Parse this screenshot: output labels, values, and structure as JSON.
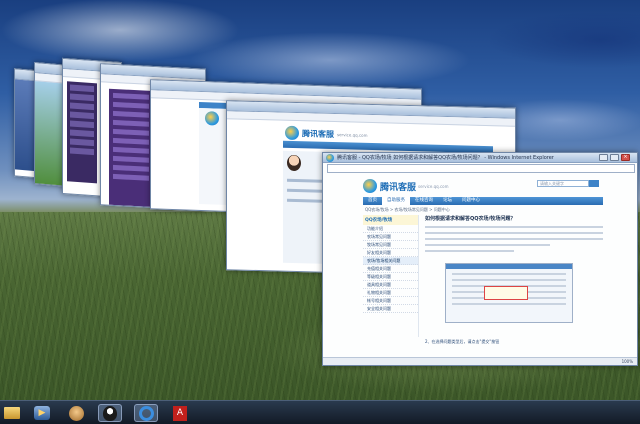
{
  "front_window": {
    "title": "腾讯客服 - QQ农场/牧场 如何根据请求和解答QQ农场/牧场问题？ - Windows Internet Explorer",
    "brand": "腾讯客服",
    "brand_sub": "service.qq.com",
    "search_placeholder": "请输入关键字",
    "nav": [
      "首页",
      "自助服务",
      "在线咨询",
      "论坛",
      "问题中心"
    ],
    "breadcrumb": "QQ农场/牧场 > 农场/牧场常见问题 > 问题中心",
    "left_head": "QQ农场/牧场",
    "left_items": [
      "功能介绍",
      "农场常见问题",
      "牧场常见问题",
      "好友相关问题",
      "农场/牧场相关问题",
      "充值相关问题",
      "等级相关问题",
      "道具相关问题",
      "礼物相关问题",
      "帐号相关问题",
      "安全相关问题"
    ],
    "article_title": "如何根据请求和解答QQ农场/牧场问题？",
    "footnote": "2、在选择问题类型后，请点击\"提交\"按钮",
    "zoom": "100%"
  },
  "middle_window": {
    "brand": "腾讯客服",
    "brand_sub": "service.qq.com"
  },
  "back_window": {
    "brand": "腾讯客服"
  },
  "taskbar": {
    "items": [
      "folder-icon",
      "media-player-icon",
      "user-avatar-icon",
      "qq-icon",
      "internet-explorer-icon",
      "pdf-reader-icon"
    ]
  },
  "colors": {
    "accent": "#2a6cb2",
    "taskbar": "#121a26"
  }
}
